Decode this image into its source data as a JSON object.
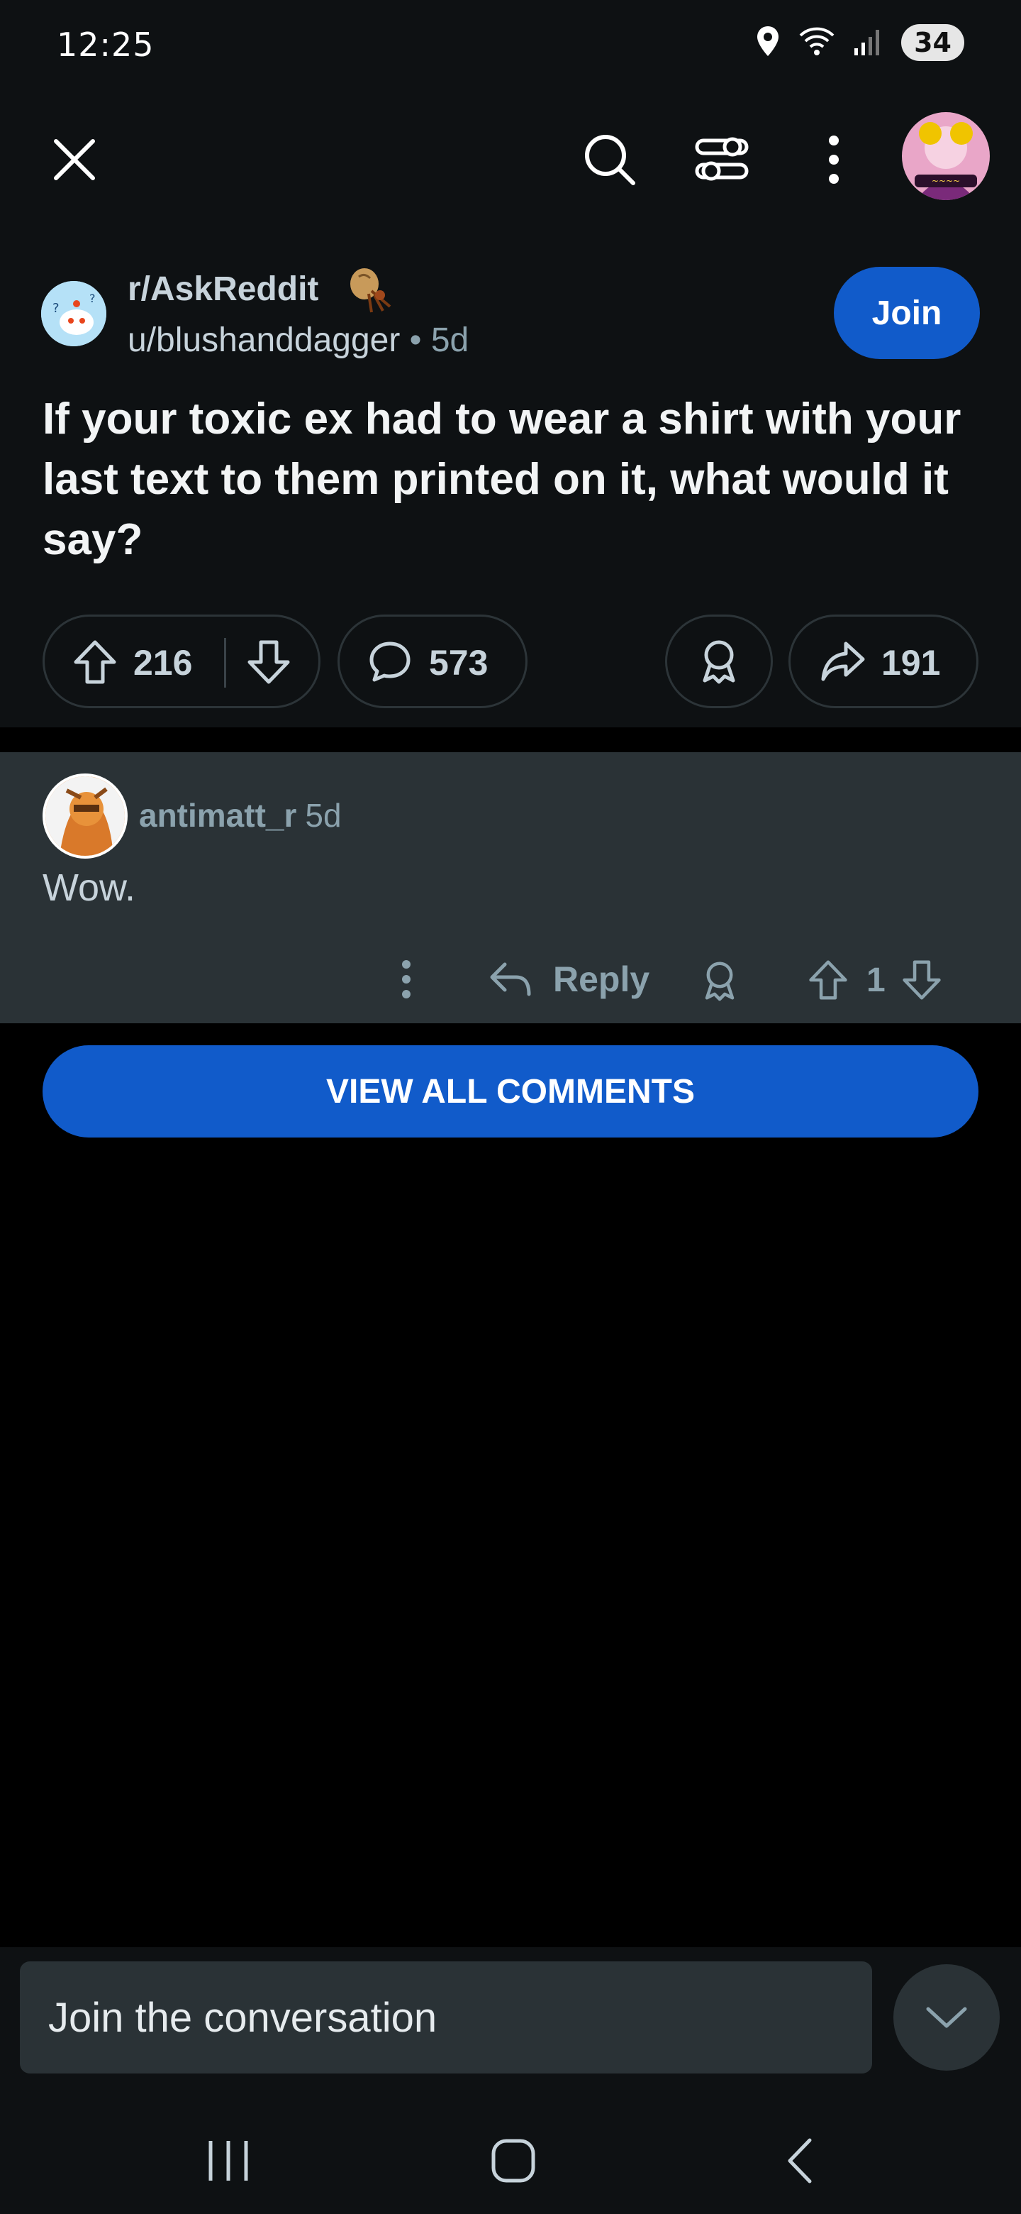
{
  "status_bar": {
    "time": "12:25",
    "battery": "34",
    "icons": [
      "location-icon",
      "wifi-icon",
      "signal-icon",
      "battery-icon"
    ]
  },
  "app_bar": {
    "icons": [
      "close-icon",
      "search-icon",
      "filter-icon",
      "more-vert-icon",
      "user-avatar"
    ]
  },
  "post": {
    "subreddit": "r/AskReddit",
    "author": "u/blushanddagger",
    "separator": "•",
    "age": "5d",
    "join_label": "Join",
    "title": "If your toxic ex had to wear a shirt with your last text to them printed on it, what would it say?",
    "score": "216",
    "comments": "573",
    "shares": "191"
  },
  "comment": {
    "author": "antimatt_r",
    "age": "5d",
    "body": "Wow.",
    "reply_label": "Reply",
    "score": "1"
  },
  "view_all_label": "VIEW ALL COMMENTS",
  "compose": {
    "placeholder": "Join the conversation"
  },
  "colors": {
    "background": "#000000",
    "surface": "#0e1113",
    "comment_surface": "#2a3236",
    "accent": "#115bca",
    "muted_text": "#8ba2ad"
  }
}
